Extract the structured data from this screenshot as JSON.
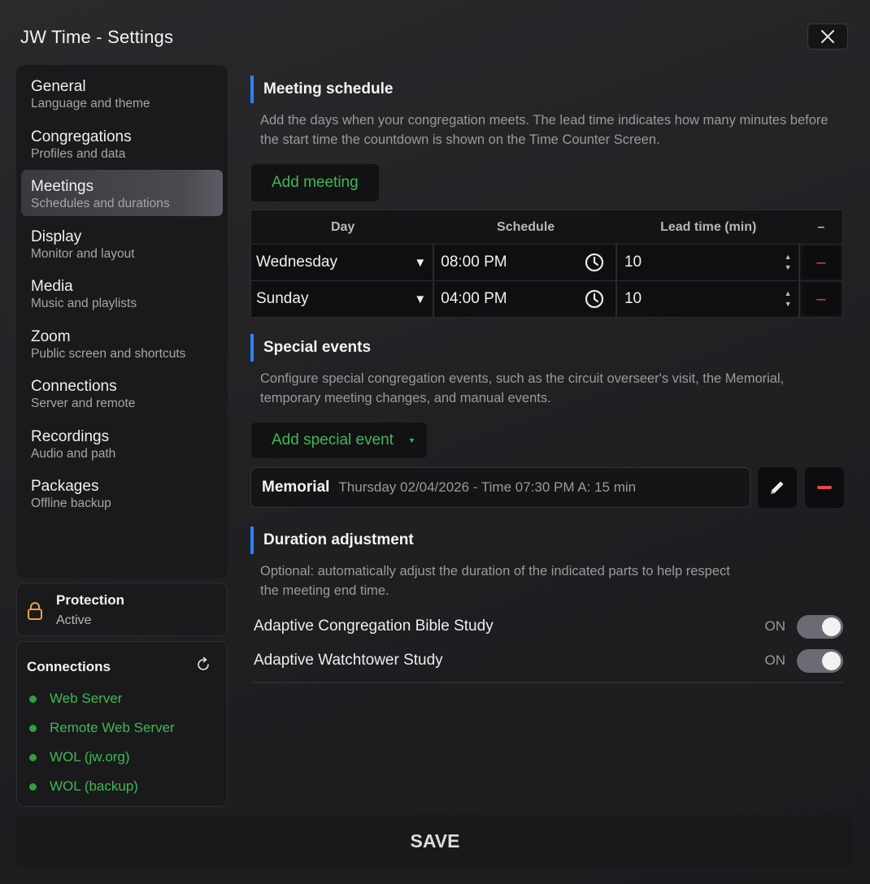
{
  "window": {
    "title": "JW Time - Settings"
  },
  "sidebar": {
    "items": [
      {
        "label": "General",
        "sub": "Language and theme"
      },
      {
        "label": "Congregations",
        "sub": "Profiles and data"
      },
      {
        "label": "Meetings",
        "sub": "Schedules and durations",
        "active": true
      },
      {
        "label": "Display",
        "sub": "Monitor and layout"
      },
      {
        "label": "Media",
        "sub": "Music and playlists"
      },
      {
        "label": "Zoom",
        "sub": "Public screen and shortcuts"
      },
      {
        "label": "Connections",
        "sub": "Server and remote"
      },
      {
        "label": "Recordings",
        "sub": "Audio and path"
      },
      {
        "label": "Packages",
        "sub": "Offline backup"
      }
    ]
  },
  "protection": {
    "title": "Protection",
    "status": "Active"
  },
  "connections": {
    "title": "Connections",
    "items": [
      "Web Server",
      "Remote Web Server",
      "WOL (jw.org)",
      "WOL (backup)"
    ],
    "status_color": "#2ea043"
  },
  "meeting_schedule": {
    "title": "Meeting schedule",
    "description": "Add the days when your congregation meets. The lead time indicates how many minutes before the start time the countdown is shown on the Time Counter Screen.",
    "add_button": "Add meeting",
    "columns": [
      "Day",
      "Schedule",
      "Lead time (min)",
      "–"
    ],
    "rows": [
      {
        "day": "Wednesday",
        "time": "08:00 PM",
        "lead": "10",
        "remove": "–"
      },
      {
        "day": "Sunday",
        "time": "04:00 PM",
        "lead": "10",
        "remove": "–"
      }
    ]
  },
  "special_events": {
    "title": "Special events",
    "description": "Configure special congregation events, such as the circuit overseer's visit, the Memorial, temporary meeting changes, and manual events.",
    "add_button": "Add special event",
    "events": [
      {
        "name": "Memorial",
        "detail": "Thursday 02/04/2026 - Time 07:30 PM A: 15 min"
      }
    ]
  },
  "duration_adjustment": {
    "title": "Duration adjustment",
    "description": "Optional: automatically adjust the duration of the indicated parts to help respect the meeting end time.",
    "toggles": [
      {
        "label": "Adaptive Congregation Bible Study",
        "state": "ON"
      },
      {
        "label": "Adaptive Watchtower Study",
        "state": "ON"
      }
    ]
  },
  "footer": {
    "save_label": "SAVE"
  },
  "colors": {
    "accent": "#2f81f7",
    "green": "#3fb950",
    "danger": "#e5484d"
  }
}
